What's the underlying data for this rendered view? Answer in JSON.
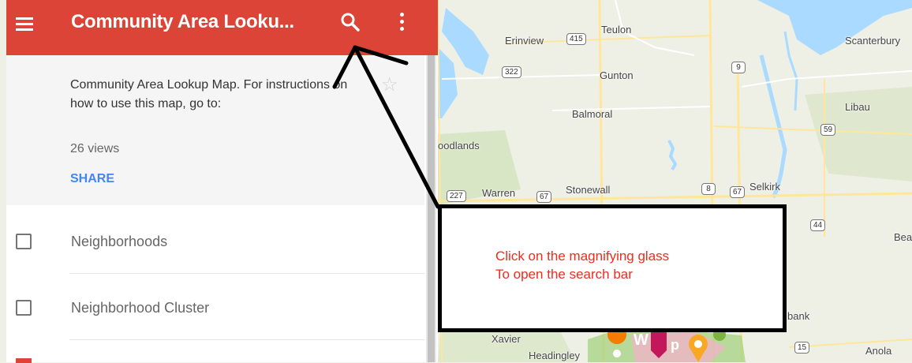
{
  "header": {
    "title": "Community Area Looku...",
    "menu_icon": "hamburger-menu-icon",
    "search_icon": "magnifying-glass-icon",
    "more_icon": "vertical-dots-icon",
    "color": "#db4437"
  },
  "info": {
    "description": "Community Area Lookup Map. For instructions on how to use this map, go to:",
    "views": "26 views",
    "share_label": "SHARE",
    "star_icon": "star-outline-icon"
  },
  "layers": [
    {
      "label": "Neighborhoods",
      "checked": false
    },
    {
      "label": "Neighborhood Cluster",
      "checked": false
    }
  ],
  "map": {
    "places": [
      "Erinview",
      "Teulon",
      "Scanterbury",
      "Gunton",
      "Libau",
      "Balmoral",
      "oodlands",
      "Warren",
      "Stonewall",
      "Selkirk",
      "Bea",
      "bank",
      "Xavier",
      "Headingley",
      "Anola"
    ],
    "shields": [
      "415",
      "322",
      "9",
      "59",
      "227",
      "67",
      "8",
      "67",
      "44",
      "15"
    ],
    "pin_glyphs": [
      "W",
      "p"
    ]
  },
  "callout": {
    "text": "Click on the magnifying glass\nTo open the search bar"
  }
}
